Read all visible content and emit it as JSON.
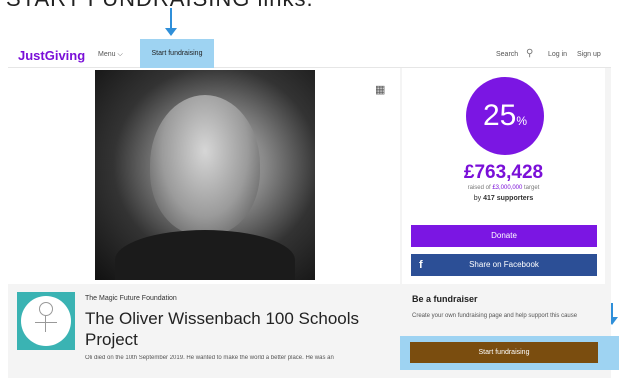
{
  "caption": "START FUNDRAISING links.",
  "header": {
    "logo": "JustGiving",
    "menu_label": "Menu ⌵",
    "start_fundraising_label": "Start fundraising",
    "search_label": "Search",
    "login_label": "Log in",
    "signup_label": "Sign up"
  },
  "progress": {
    "percent": "25",
    "percent_sign": "%",
    "amount": "£763,428",
    "raised_prefix": "raised of",
    "target": "£3,000,000",
    "target_suffix": "target",
    "supporters_prefix": "by",
    "supporters_count": "417",
    "supporters_suffix": "supporters"
  },
  "actions": {
    "donate_label": "Donate",
    "share_label": "Share on Facebook"
  },
  "page": {
    "foundation": "The Magic Future Foundation",
    "title": "The Oliver Wissenbach 100 Schools Project",
    "excerpt": "Oli died on the 10th September 2019. He wanted to make the world a better place. He was an"
  },
  "fundraiser": {
    "heading": "Be a fundraiser",
    "description": "Create your own fundraising page and help support this cause",
    "button_label": "Start fundraising"
  },
  "colors": {
    "brand_purple": "#7b16e3",
    "facebook_blue": "#2c4f96",
    "highlight_blue": "#9ed3f2",
    "start_button_brown": "#7a4d0f",
    "arrow_blue": "#2f8fd9"
  }
}
